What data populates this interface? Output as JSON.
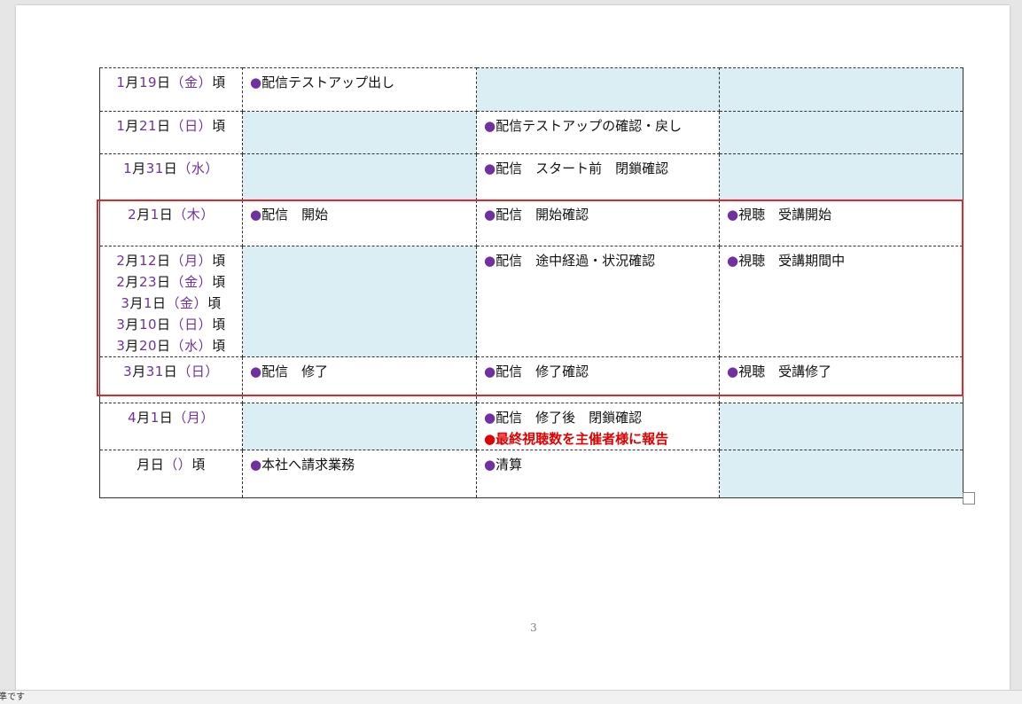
{
  "rows": [
    {
      "dates": [
        {
          "m": "1",
          "d": "19",
          "w": "金",
          "suffix": "頃"
        }
      ],
      "col1": "配信テストアップ出し",
      "col2": "",
      "col3": ""
    },
    {
      "dates": [
        {
          "m": "1",
          "d": "21",
          "w": "日",
          "suffix": "頃"
        }
      ],
      "col1": "",
      "col2": "配信テストアップの確認・戻し",
      "col3": ""
    },
    {
      "dates": [
        {
          "m": "1",
          "d": "31",
          "w": "水",
          "suffix": ""
        }
      ],
      "col1": "",
      "col2": "配信　スタート前　閉鎖確認",
      "col3": ""
    },
    {
      "dates": [
        {
          "m": "2",
          "d": "1",
          "w": "木",
          "suffix": ""
        }
      ],
      "col1": "配信　開始",
      "col2": "配信　開始確認",
      "col3": "視聴　受講開始"
    },
    {
      "dates": [
        {
          "m": "2",
          "d": "12",
          "w": "月",
          "suffix": "頃"
        },
        {
          "m": "2",
          "d": "23",
          "w": "金",
          "suffix": "頃"
        },
        {
          "m": "3",
          "d": "1",
          "w": "金",
          "suffix": "頃"
        },
        {
          "m": "3",
          "d": "10",
          "w": "日",
          "suffix": "頃"
        },
        {
          "m": "3",
          "d": "20",
          "w": "水",
          "suffix": "頃"
        }
      ],
      "col1": "",
      "col2": "配信　途中経過・状況確認",
      "col3": "視聴　受講期間中"
    },
    {
      "dates": [
        {
          "m": "3",
          "d": "31",
          "w": "日",
          "suffix": ""
        }
      ],
      "col1": "配信　修了",
      "col2": "配信　修了確認",
      "col3": "視聴　受講修了"
    },
    {
      "dates": [
        {
          "m": "4",
          "d": "1",
          "w": "月",
          "suffix": ""
        }
      ],
      "col1": "",
      "col2": "配信　修了後　閉鎖確認",
      "col2_extra": "最終視聴数を主催者様に報告",
      "col3": ""
    },
    {
      "dates": [
        {
          "m": "",
          "d": "",
          "w": "",
          "suffix": "頃"
        }
      ],
      "col1": "本社へ請求業務",
      "col2": "清算",
      "col3": ""
    }
  ],
  "symbols": {
    "bullet": "●",
    "month": "月",
    "day": "日",
    "open_paren": "（",
    "close_paren": "）"
  },
  "page_number": "3",
  "status_text": "準です",
  "colors": {
    "shade": "#dbeef4",
    "bullet": "#7030a0",
    "highlight_box": "#e3262a",
    "report_red": "#e00000"
  }
}
